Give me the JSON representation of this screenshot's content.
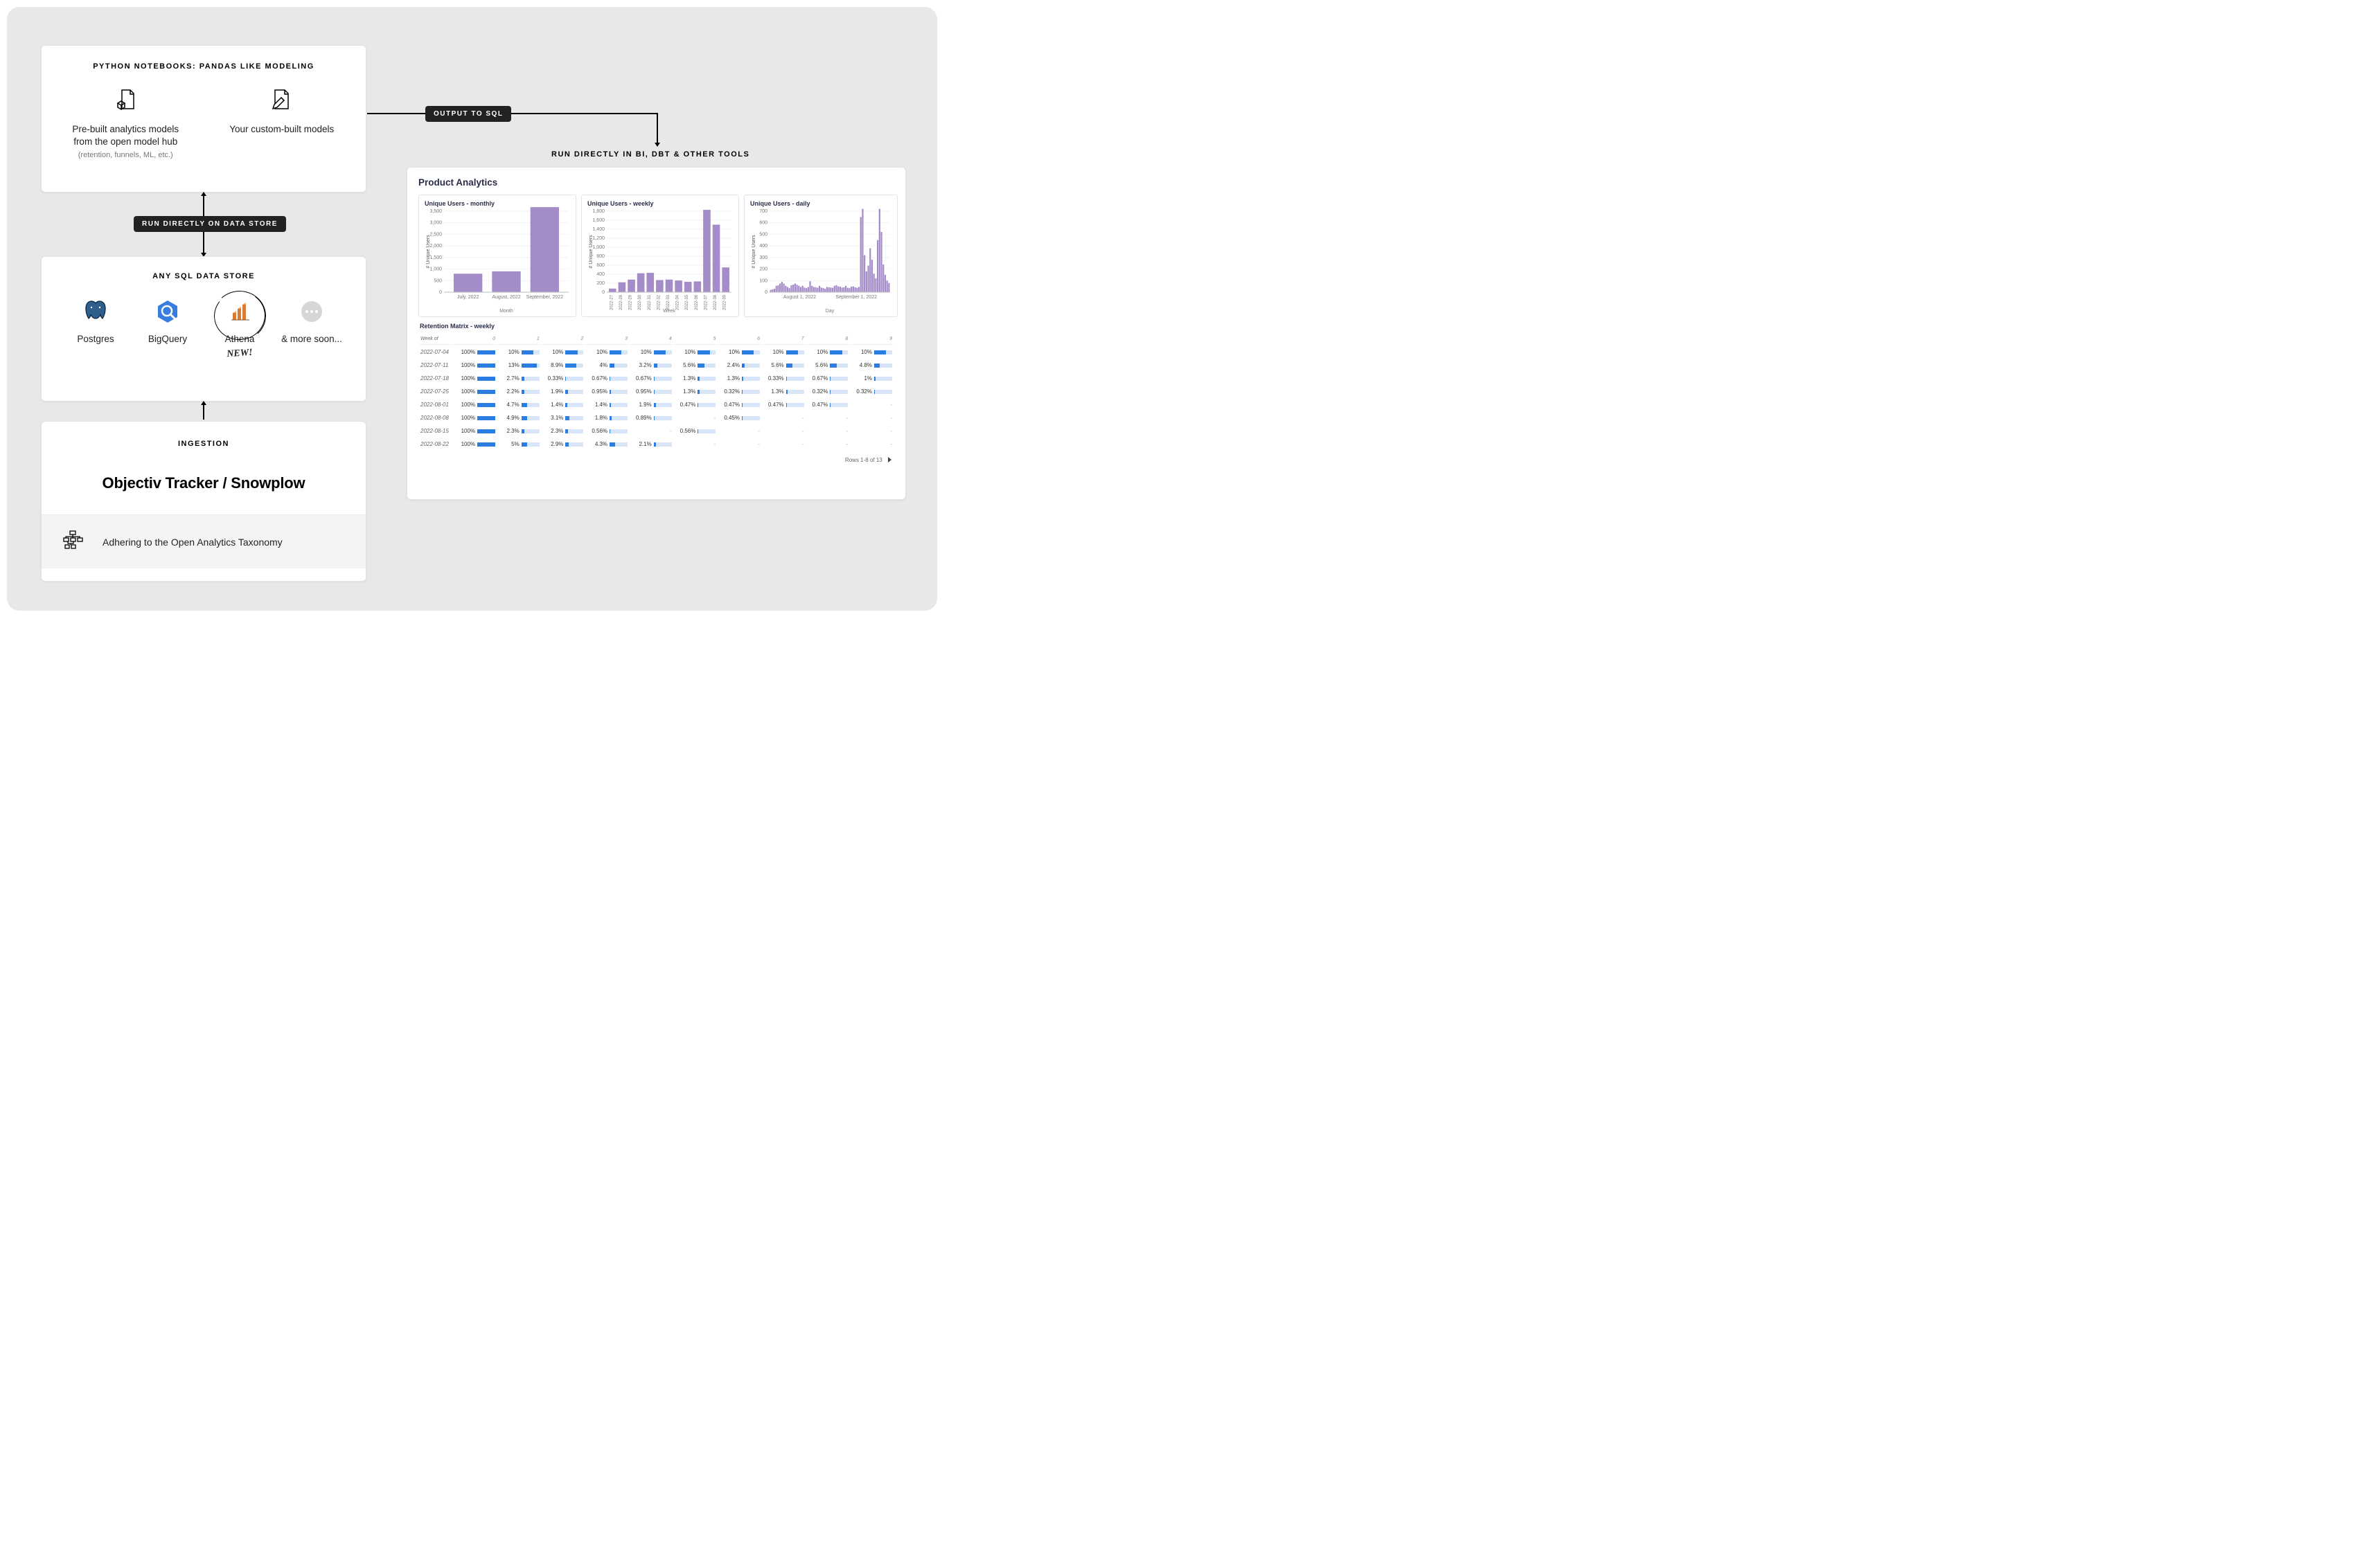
{
  "notebooks": {
    "title": "PYTHON NOTEBOOKS: PANDAS LIKE MODELING",
    "prebuilt": {
      "line1": "Pre-built analytics models",
      "line2": "from the open model hub",
      "sub": "(retention, funnels, ML, etc.)"
    },
    "custom": {
      "line": "Your custom-built models"
    }
  },
  "labels": {
    "run_on_store": "RUN DIRECTLY ON DATA STORE",
    "output_sql": "OUTPUT TO SQL",
    "bi_title": "RUN DIRECTLY IN BI, DBT & OTHER TOOLS"
  },
  "datastore": {
    "title": "ANY SQL DATA STORE",
    "items": [
      "Postgres",
      "BigQuery",
      "Athena",
      "& more soon..."
    ],
    "new": "NEW!"
  },
  "ingestion": {
    "title": "INGESTION",
    "name": "Objectiv Tracker / Snowplow",
    "taxonomy": "Adhering to the Open Analytics Taxonomy"
  },
  "dashboard": {
    "title": "Product Analytics",
    "retention_title": "Retention Matrix - weekly",
    "week_of": "Week of",
    "rows_footer": "Rows 1-8 of 13"
  },
  "chart_data": [
    {
      "type": "bar",
      "title": "Unique Users - monthly",
      "xlabel": "Month",
      "ylabel": "# Unique Users",
      "ylim": [
        0,
        3500
      ],
      "yticks": [
        0,
        500,
        1000,
        1500,
        2000,
        2500,
        3000,
        3500
      ],
      "categories": [
        "July, 2022",
        "August, 2022",
        "September, 2022"
      ],
      "values": [
        800,
        900,
        3700
      ]
    },
    {
      "type": "bar",
      "title": "Unique Users - weekly",
      "xlabel": "Week",
      "ylabel": "# Unique Users",
      "ylim": [
        0,
        1800
      ],
      "yticks": [
        0,
        200,
        400,
        600,
        800,
        1000,
        1200,
        1400,
        1600,
        1800
      ],
      "categories": [
        "2022-27",
        "2022-28",
        "2022-29",
        "2022-30",
        "2022-31",
        "2022-32",
        "2022-33",
        "2022-34",
        "2022-35",
        "2022-36",
        "2022-37",
        "2022-38",
        "2022-39"
      ],
      "values": [
        80,
        220,
        280,
        420,
        430,
        270,
        280,
        260,
        230,
        240,
        1830,
        1500,
        550
      ]
    },
    {
      "type": "bar",
      "title": "Unique Users - daily",
      "xlabel": "Day",
      "ylabel": "# Unique Users",
      "ylim": [
        0,
        700
      ],
      "yticks": [
        0,
        100,
        200,
        300,
        400,
        500,
        600,
        700
      ],
      "categories": [
        "August 1, 2022",
        "September 1, 2022"
      ],
      "values_series": [
        20,
        25,
        30,
        55,
        60,
        75,
        90,
        75,
        55,
        45,
        35,
        60,
        65,
        75,
        65,
        55,
        45,
        55,
        40,
        35,
        45,
        95,
        55,
        45,
        42,
        38,
        55,
        40,
        35,
        30,
        45,
        42,
        40,
        38,
        55,
        60,
        50,
        48,
        40,
        42,
        55,
        38,
        35,
        48,
        50,
        42,
        38,
        45,
        650,
        720,
        320,
        180,
        230,
        380,
        280,
        160,
        120,
        450,
        720,
        520,
        240,
        150,
        100,
        80
      ]
    },
    {
      "type": "table",
      "title": "Retention Matrix - weekly",
      "column_headers": [
        "Week of",
        "0",
        "1",
        "2",
        "3",
        "4",
        "5",
        "6",
        "7",
        "8",
        "9"
      ],
      "rows": [
        {
          "week": "2022-07-04",
          "cells": [
            "100%",
            "10%",
            "10%",
            "10%",
            "10%",
            "10%",
            "10%",
            "10%",
            "10%",
            "10%"
          ]
        },
        {
          "week": "2022-07-11",
          "cells": [
            "100%",
            "13%",
            "8.9%",
            "4%",
            "3.2%",
            "5.6%",
            "2.4%",
            "5.6%",
            "5.6%",
            "4.8%"
          ]
        },
        {
          "week": "2022-07-18",
          "cells": [
            "100%",
            "2.7%",
            "0.33%",
            "0.67%",
            "0.67%",
            "1.3%",
            "1.3%",
            "0.33%",
            "0.67%",
            "1%"
          ]
        },
        {
          "week": "2022-07-25",
          "cells": [
            "100%",
            "2.2%",
            "1.9%",
            "0.95%",
            "0.95%",
            "1.3%",
            "0.32%",
            "1.3%",
            "0.32%",
            "0.32%"
          ]
        },
        {
          "week": "2022-08-01",
          "cells": [
            "100%",
            "4.7%",
            "1.4%",
            "1.4%",
            "1.9%",
            "0.47%",
            "0.47%",
            "0.47%",
            "0.47%",
            "-"
          ]
        },
        {
          "week": "2022-08-08",
          "cells": [
            "100%",
            "4.9%",
            "3.1%",
            "1.8%",
            "0.89%",
            "-",
            "0.45%",
            "-",
            "-",
            "-"
          ]
        },
        {
          "week": "2022-08-15",
          "cells": [
            "100%",
            "2.3%",
            "2.3%",
            "0.56%",
            "-",
            "0.56%",
            "-",
            "-",
            "-",
            "-"
          ]
        },
        {
          "week": "2022-08-22",
          "cells": [
            "100%",
            "5%",
            "2.9%",
            "4.3%",
            "2.1%",
            "-",
            "-",
            "-",
            "-",
            "-"
          ]
        }
      ]
    }
  ]
}
